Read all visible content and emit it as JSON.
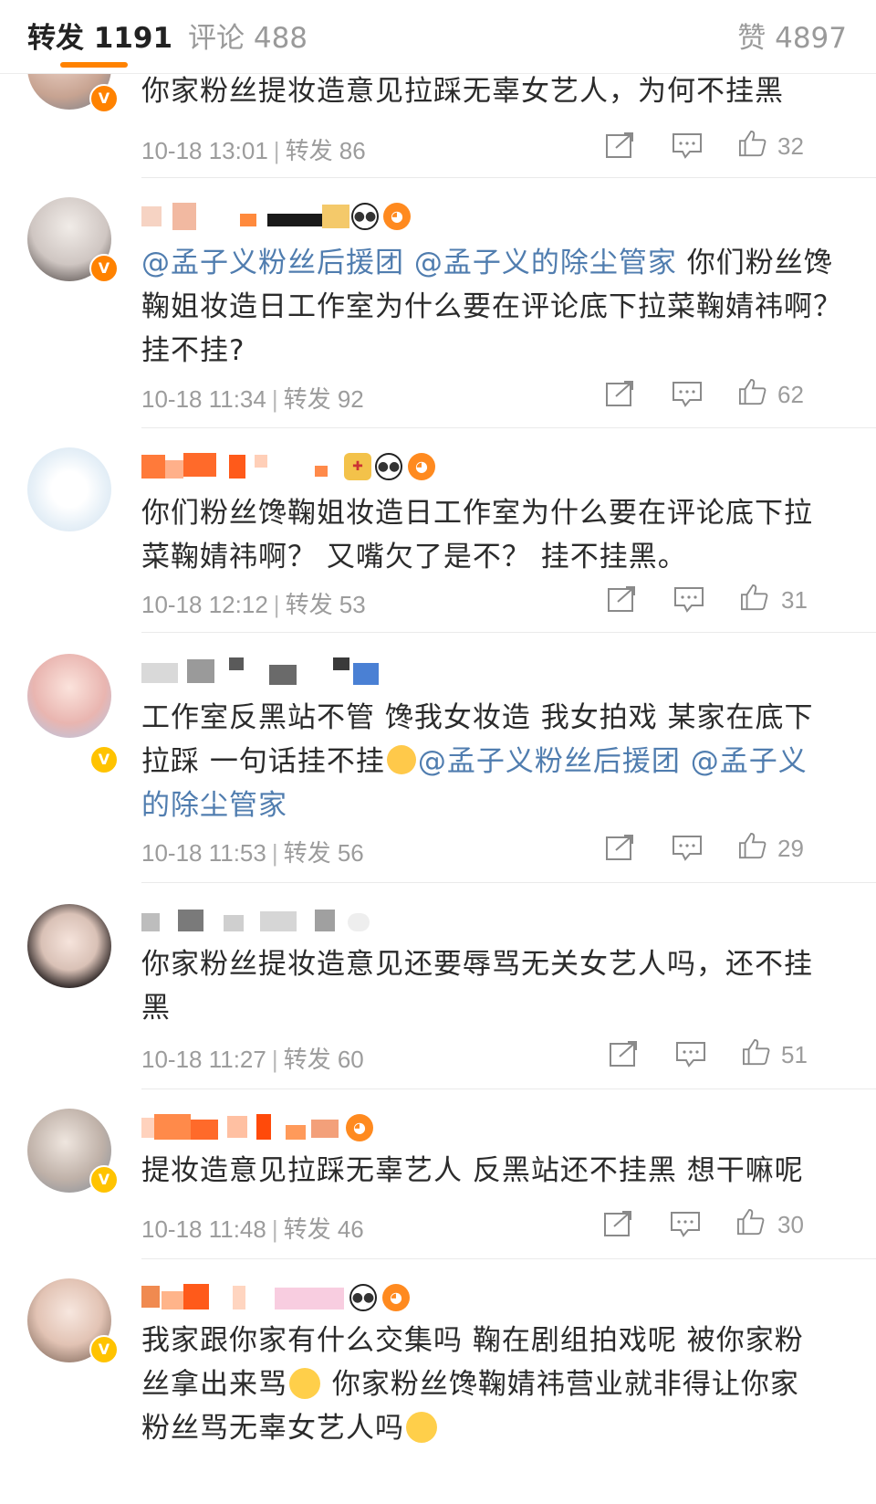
{
  "tabs": {
    "repost": "转发 1191",
    "comment": "评论 488",
    "like": "赞 4897"
  },
  "accent_color": "#ff8200",
  "link_color": "#507daf",
  "icons": [
    "share-icon",
    "comment-icon",
    "thumbs-up-icon",
    "verified-badge-icon"
  ],
  "posts": [
    {
      "content": "你家粉丝提妆造意见拉踩无辜女艺人，为何不挂黑",
      "time": "10-18 13:01",
      "repost_label": "转发 86",
      "likes": "32"
    },
    {
      "mention1": "@孟子义粉丝后援团",
      "mention2": "@孟子义的除尘管家",
      "content_tail": " 你们粉丝馋鞠姐妆造日工作室为什么要在评论底下拉菜鞠婧祎啊？挂不挂?",
      "time": "10-18 11:34",
      "repost_label": "转发 92",
      "likes": "62"
    },
    {
      "content": "你们粉丝馋鞠姐妆造日工作室为什么要在评论底下拉菜鞠婧祎啊？ 又嘴欠了是不？ 挂不挂黑。",
      "time": "10-18 12:12",
      "repost_label": "转发 53",
      "likes": "31"
    },
    {
      "content_head": "工作室反黑站不管 馋我女妆造 我女拍戏 某家在底下拉踩 一句话挂不挂",
      "mention1": "@孟子义粉丝后援团",
      "mention2": "@孟子义的除尘管家",
      "time": "10-18 11:53",
      "repost_label": "转发 56",
      "likes": "29"
    },
    {
      "content": "你家粉丝提妆造意见还要辱骂无关女艺人吗，还不挂黑",
      "time": "10-18 11:27",
      "repost_label": "转发 60",
      "likes": "51"
    },
    {
      "content": "提妆造意见拉踩无辜艺人 反黑站还不挂黑 想干嘛呢",
      "time": "10-18 11:48",
      "repost_label": "转发 46",
      "likes": "30"
    },
    {
      "content_a": "我家跟你家有什么交集吗 鞠在剧组拍戏呢 被你家粉丝拿出来骂",
      "content_b": " 你家粉丝馋鞠婧祎营业就非得让你家粉丝骂无辜女艺人吗"
    }
  ]
}
